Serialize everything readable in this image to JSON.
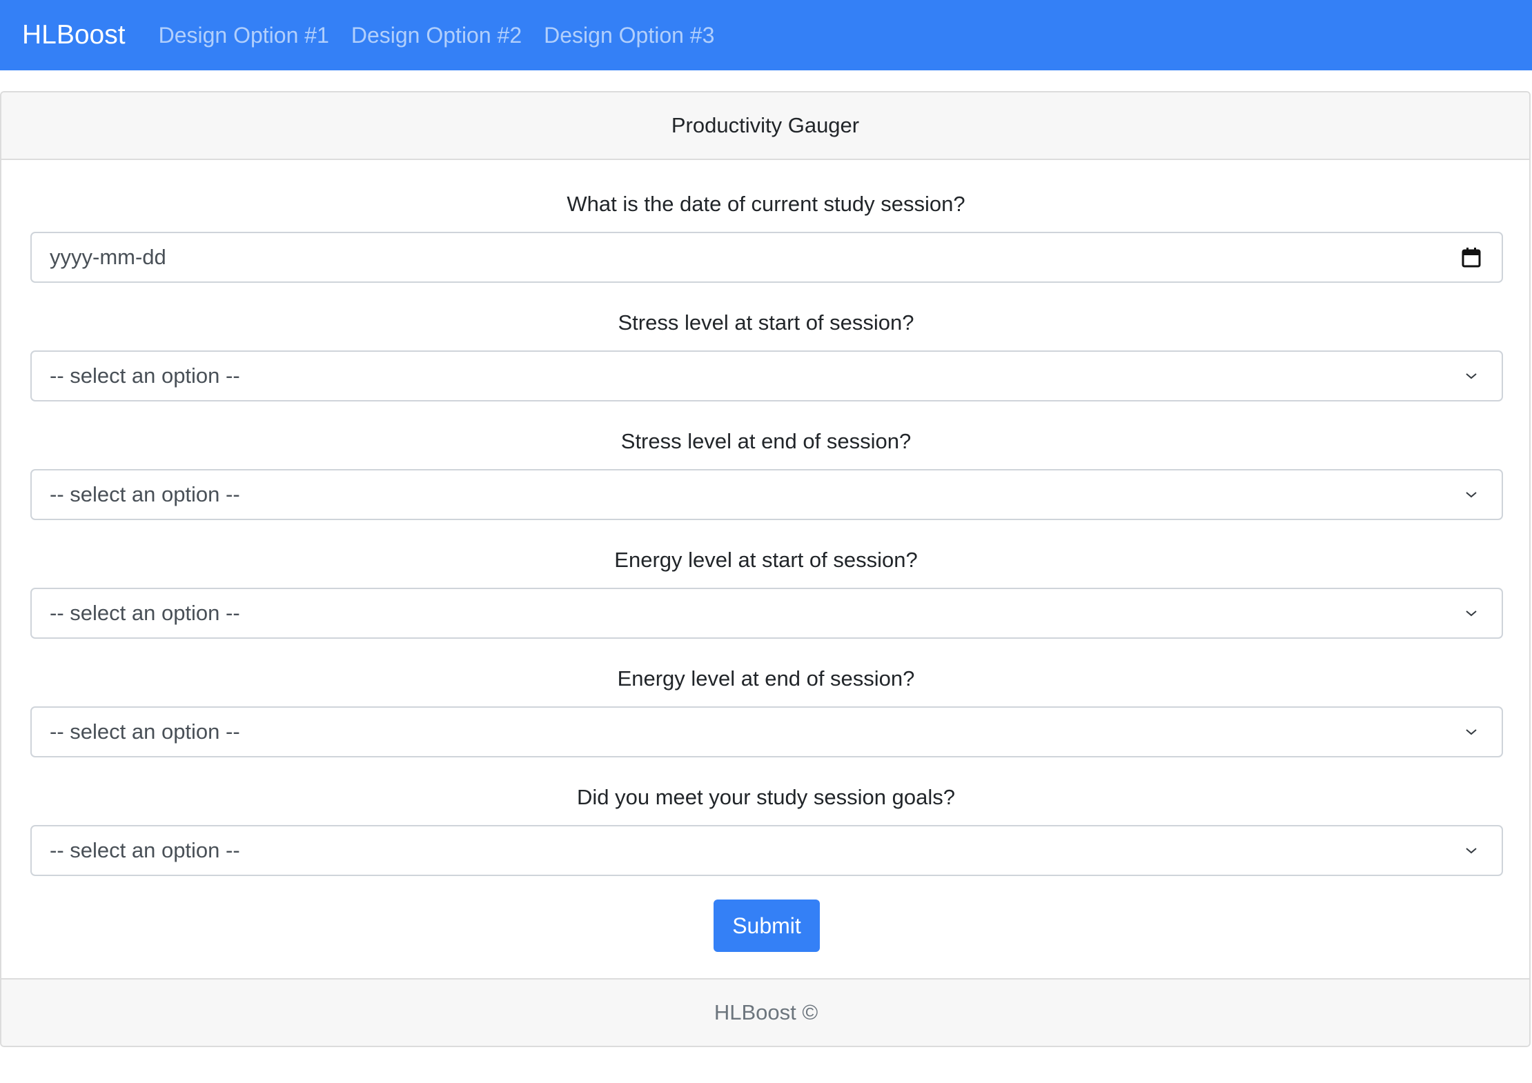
{
  "navbar": {
    "brand": "HLBoost",
    "links": [
      "Design Option #1",
      "Design Option #2",
      "Design Option #3"
    ]
  },
  "card": {
    "title": "Productivity Gauger",
    "fields": [
      {
        "label": "What is the date of current study session?",
        "value": "yyyy-mm-dd",
        "icon": "calendar-icon"
      },
      {
        "label": "Stress level at start of session?",
        "value": "-- select an option --",
        "icon": "chevron-down-icon"
      },
      {
        "label": "Stress level at end of session?",
        "value": "-- select an option --",
        "icon": "chevron-down-icon"
      },
      {
        "label": "Energy level at start of session?",
        "value": "-- select an option --",
        "icon": "chevron-down-icon"
      },
      {
        "label": "Energy level at end of session?",
        "value": "-- select an option --",
        "icon": "chevron-down-icon"
      },
      {
        "label": "Did you meet your study session goals?",
        "value": "-- select an option --",
        "icon": "chevron-down-icon"
      }
    ],
    "submit_label": "Submit",
    "footer": "HLBoost ©"
  },
  "colors": {
    "primary": "#3480f6",
    "header_bg": "#f7f7f7",
    "border": "#dcdcdc"
  }
}
